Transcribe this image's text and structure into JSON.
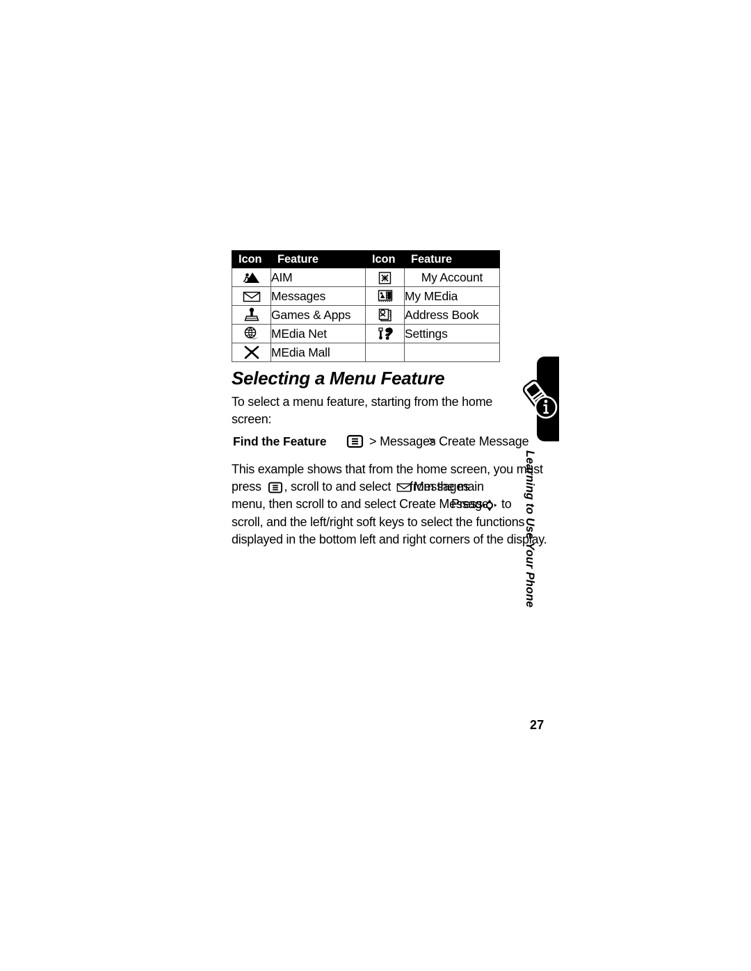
{
  "table": {
    "headers": [
      "Icon",
      "Feature",
      "Icon",
      "Feature"
    ],
    "rows": [
      {
        "icon_left": "aim-running-person-icon",
        "feature_left": "AIM",
        "icon_right": "my-account-x-box-icon",
        "feature_right": "My Account"
      },
      {
        "icon_left": "messages-envelope-icon",
        "feature_left": "Messages",
        "icon_right": "my-media-film-icon",
        "feature_right": "My MEdia"
      },
      {
        "icon_left": "games-apps-joystick-icon",
        "feature_left": "Games & Apps",
        "icon_right": "address-book-icon",
        "feature_right": "Address Book"
      },
      {
        "icon_left": "media-net-globe-icon",
        "feature_left": "MEdia Net",
        "icon_right": "settings-tools-icon",
        "feature_right": "Settings"
      },
      {
        "icon_left": "media-mall-person-icon",
        "feature_left": "MEdia Mall",
        "icon_right": "",
        "feature_right": ""
      }
    ]
  },
  "section": {
    "heading": "Selecting a Menu Feature",
    "intro": "To select a menu feature, starting from the home screen:"
  },
  "find_feature": {
    "label": "Find the Feature",
    "menu_icon": "menu-key-icon",
    "path_part1": "> Messages",
    "path_part2": "> Create Message"
  },
  "body": {
    "line1": "This example shows that from the home screen, you must",
    "line2_a": "press",
    "line2_icon": "menu-key-icon",
    "line2_b": ", scroll to and select",
    "line2_envelope": "messages-envelope-icon",
    "line2_c": "Messages",
    "line2_d": "from the main",
    "line3_a": "menu, then scroll to and select Create Message",
    "line3_b": "Press",
    "line3_icon": "navigation-key-icon",
    "line3_c": "to",
    "line4": "scroll, and the left/right soft keys to select the functions",
    "line5": "displayed in the bottom left and right corners of the display."
  },
  "sidebar": {
    "tab_icon": "phone-info-icon",
    "label": "Learning to Use Your Phone"
  },
  "footer": {
    "page_number": "27"
  },
  "colors": {
    "header_bg": "#000000",
    "header_text": "#ffffff",
    "body_text": "#000000",
    "border": "#565656",
    "page_bg": "#ffffff"
  }
}
